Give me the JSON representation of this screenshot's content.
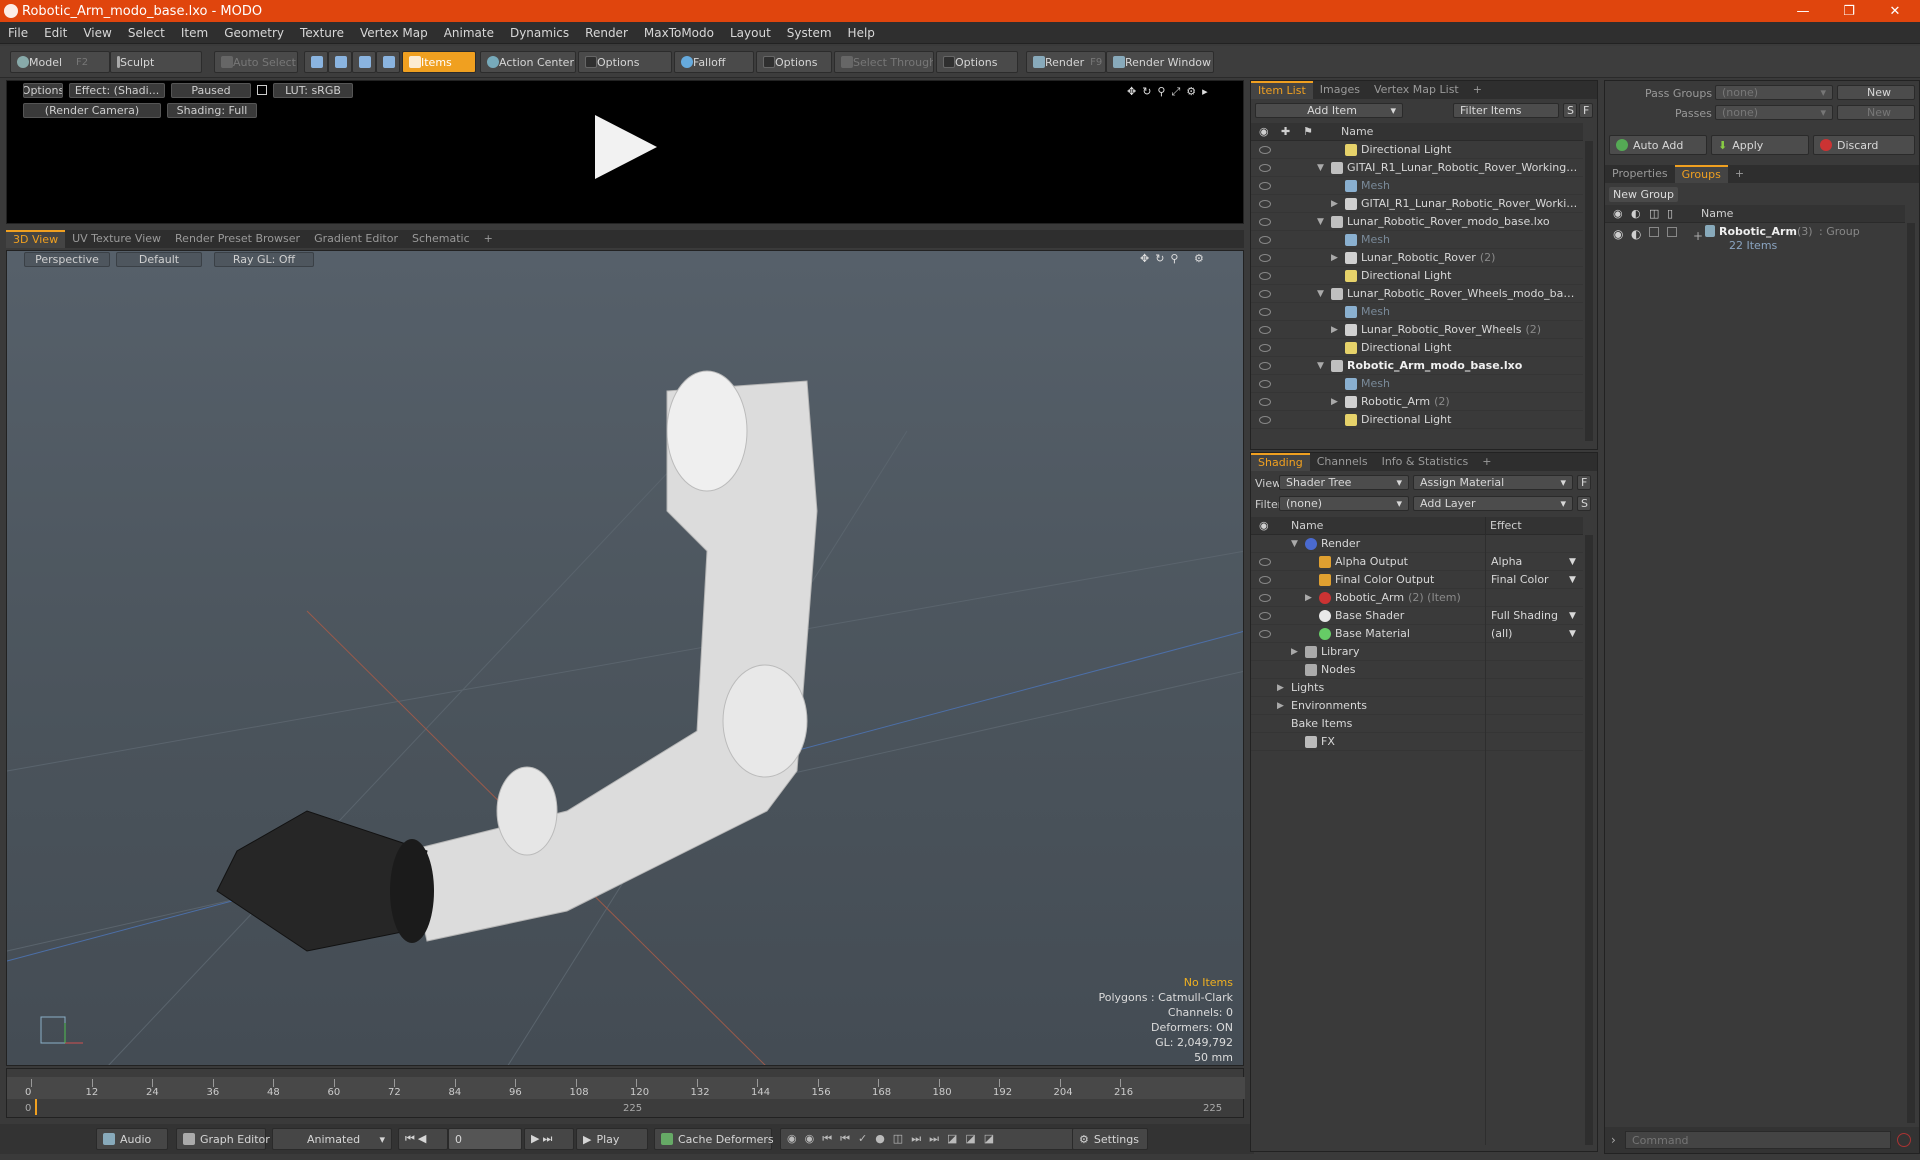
{
  "window": {
    "title": "Robotic_Arm_modo_base.lxo - MODO"
  },
  "menu": [
    "File",
    "Edit",
    "View",
    "Select",
    "Item",
    "Geometry",
    "Texture",
    "Vertex Map",
    "Animate",
    "Dynamics",
    "Render",
    "MaxToModo",
    "Layout",
    "System",
    "Help"
  ],
  "toolbar": {
    "model": "Model",
    "model_key": "F2",
    "sculpt": "Sculpt",
    "auto_select": "Auto Select",
    "items": "Items",
    "action_center": "Action Center",
    "options1": "Options",
    "falloff": "Falloff",
    "options2": "Options",
    "select_through": "Select Through",
    "options3": "Options",
    "render": "Render",
    "render_key": "F9",
    "render_window": "Render Window"
  },
  "preview": {
    "options": "Options",
    "effect": "Effect: (Shadi...",
    "paused": "Paused",
    "lut": "LUT: sRGB",
    "camera": "(Render Camera)",
    "shading": "Shading: Full"
  },
  "viewport_tabs": [
    "3D View",
    "UV Texture View",
    "Render Preset Browser",
    "Gradient Editor",
    "Schematic"
  ],
  "viewport": {
    "projection": "Perspective",
    "style": "Default",
    "raygl": "Ray GL: Off",
    "stats": {
      "no_items": "No Items",
      "polygons": "Polygons : Catmull-Clark",
      "channels": "Channels: 0",
      "deformers": "Deformers: ON",
      "gl": "GL: 2,049,792",
      "lens": "50 mm"
    }
  },
  "timeline": {
    "ticks": [
      "0",
      "12",
      "24",
      "36",
      "48",
      "60",
      "72",
      "84",
      "96",
      "108",
      "120",
      "132",
      "144",
      "156",
      "168",
      "180",
      "192",
      "204",
      "216"
    ],
    "start": "0",
    "mid": "225",
    "end": "225"
  },
  "bottombar": {
    "audio": "Audio",
    "graph_editor": "Graph Editor",
    "animated": "Animated",
    "frame": "0",
    "play": "Play",
    "cache_deformers": "Cache Deformers",
    "settings": "Settings"
  },
  "itemlist": {
    "tabs": [
      "Item List",
      "Images",
      "Vertex Map List"
    ],
    "add_item": "Add Item",
    "filter_items": "Filter Items",
    "s": "S",
    "f": "F",
    "col_name": "Name",
    "rows": [
      {
        "label": "Directional Light",
        "indent": 2,
        "type": "light"
      },
      {
        "label": "GITAI_R1_Lunar_Robotic_Rover_Working ...",
        "indent": 1,
        "type": "scene",
        "open": true
      },
      {
        "label": "Mesh",
        "indent": 2,
        "type": "mesh",
        "gray": true
      },
      {
        "label": "GITAI_R1_Lunar_Robotic_Rover_Worki ...",
        "indent": 2,
        "type": "group",
        "closed": true
      },
      {
        "label": "Lunar_Robotic_Rover_modo_base.lxo",
        "indent": 1,
        "type": "scene",
        "open": true
      },
      {
        "label": "Mesh",
        "indent": 2,
        "type": "mesh",
        "gray": true
      },
      {
        "label": "Lunar_Robotic_Rover",
        "count": "(2)",
        "indent": 2,
        "type": "group",
        "closed": true
      },
      {
        "label": "Directional Light",
        "indent": 2,
        "type": "light"
      },
      {
        "label": "Lunar_Robotic_Rover_Wheels_modo_bas ...",
        "indent": 1,
        "type": "scene",
        "open": true
      },
      {
        "label": "Mesh",
        "indent": 2,
        "type": "mesh",
        "gray": true
      },
      {
        "label": "Lunar_Robotic_Rover_Wheels",
        "count": "(2)",
        "indent": 2,
        "type": "group",
        "closed": true
      },
      {
        "label": "Directional Light",
        "indent": 2,
        "type": "light"
      },
      {
        "label": "Robotic_Arm_modo_base.lxo",
        "indent": 1,
        "type": "scene",
        "open": true,
        "bold": true
      },
      {
        "label": "Mesh",
        "indent": 2,
        "type": "mesh",
        "gray": true
      },
      {
        "label": "Robotic_Arm",
        "count": "(2)",
        "indent": 2,
        "type": "group",
        "closed": true
      },
      {
        "label": "Directional Light",
        "indent": 2,
        "type": "light"
      }
    ]
  },
  "shading": {
    "tabs": [
      "Shading",
      "Channels",
      "Info & Statistics"
    ],
    "view_label": "View",
    "view_value": "Shader Tree",
    "assign_material": "Assign Material",
    "f": "F",
    "filter_label": "Filter",
    "filter_value": "(none)",
    "add_layer": "Add Layer",
    "s": "S",
    "col_name": "Name",
    "col_effect": "Effect",
    "rows": [
      {
        "label": "Render",
        "effect": "",
        "indent": 0,
        "type": "render",
        "open": true
      },
      {
        "label": "Alpha Output",
        "effect": "Alpha",
        "indent": 1,
        "type": "output"
      },
      {
        "label": "Final Color Output",
        "effect": "Final Color",
        "indent": 1,
        "type": "output"
      },
      {
        "label": "Robotic_Arm",
        "count": "(2) (Item)",
        "effect": "",
        "indent": 1,
        "type": "material_group",
        "closed": true
      },
      {
        "label": "Base Shader",
        "effect": "Full Shading",
        "indent": 1,
        "type": "shader"
      },
      {
        "label": "Base Material",
        "effect": "(all)",
        "indent": 1,
        "type": "material"
      },
      {
        "label": "Library",
        "effect": "",
        "indent": 0,
        "type": "folder",
        "closed": true
      },
      {
        "label": "Nodes",
        "effect": "",
        "indent": 0,
        "type": "folder"
      },
      {
        "label": "Lights",
        "effect": "",
        "indent": -1,
        "type": "none",
        "closed": true
      },
      {
        "label": "Environments",
        "effect": "",
        "indent": -1,
        "type": "none",
        "closed": true
      },
      {
        "label": "Bake Items",
        "effect": "",
        "indent": -1,
        "type": "none"
      },
      {
        "label": "FX",
        "effect": "",
        "indent": 0,
        "type": "fx"
      }
    ]
  },
  "rightpanel": {
    "pass_groups_label": "Pass Groups",
    "pass_groups_value": "(none)",
    "new1": "New",
    "passes_label": "Passes",
    "passes_value": "(none)",
    "new2": "New",
    "auto_add": "Auto Add",
    "apply": "Apply",
    "discard": "Discard",
    "tabs": [
      "Properties",
      "Groups"
    ],
    "new_group": "New Group",
    "col_name": "Name",
    "group_name": "Robotic_Arm",
    "group_count": "(3)",
    "group_type": ": Group",
    "group_items": "22 Items",
    "command_placeholder": "Command"
  },
  "colors": {
    "accent": "#f0a020",
    "titlebar": "#e0450d"
  }
}
